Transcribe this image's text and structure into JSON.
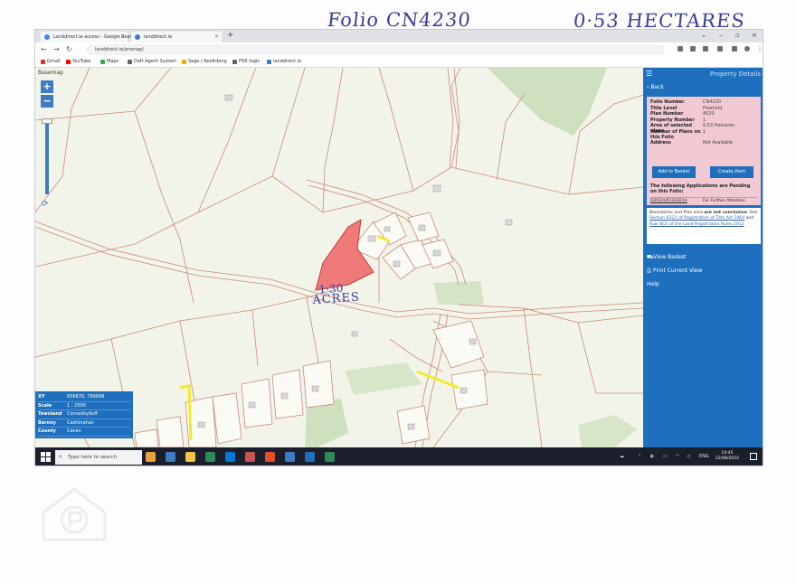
{
  "handwritten": {
    "folio": "Folio CN4230",
    "hectares": "0·53 HECTARES",
    "acres_line1": "1·30",
    "acres_line2": "ACRES"
  },
  "browser": {
    "tabs": [
      {
        "label": "Landdirect.ie access - Google Search",
        "color": "#4285f4"
      },
      {
        "label": "landdirect.ie",
        "color": "#3e7cc3"
      }
    ],
    "new_tab": "+",
    "url": "landdirect.ie/pramap/",
    "bookmarks": [
      {
        "label": "Gmail",
        "color": "#d93025"
      },
      {
        "label": "YouTube",
        "color": "#ff0000"
      },
      {
        "label": "Maps",
        "color": "#34a853"
      },
      {
        "label": "Daft Agent System",
        "color": "#5f6368"
      },
      {
        "label": "Sage | Realtdeng",
        "color": "#f9ab00"
      },
      {
        "label": "PSR login",
        "color": "#5f6368"
      },
      {
        "label": "landdirect.ie",
        "color": "#3e7cc3"
      }
    ]
  },
  "map": {
    "basemap_label": "Basemap",
    "zoom_in": "+",
    "zoom_out": "−",
    "colors": {
      "land": "#f2f4e9",
      "boundary": "#c98a7a",
      "highlight": "#f07a7a",
      "highlight_stroke": "#c03a3a",
      "yellow": "#f4ea2a",
      "forest": "#cfe0bf",
      "building": "#d8d8d8"
    },
    "info": [
      {
        "key": "XY",
        "value": "656870, 789999"
      },
      {
        "key": "Scale",
        "value": "1 : 2500"
      },
      {
        "key": "Townland",
        "value": "Cornadoyduff"
      },
      {
        "key": "Barony",
        "value": "Castlerahan"
      },
      {
        "key": "County",
        "value": "Cavan"
      }
    ]
  },
  "panel": {
    "title": "Property Details",
    "back": "Back",
    "fields": [
      {
        "key": "Folio Number",
        "value": "CN4230"
      },
      {
        "key": "Title Level",
        "value": "Freehold"
      },
      {
        "key": "Plan Number",
        "value": "4020"
      },
      {
        "key": "Property Number",
        "value": "1"
      },
      {
        "key": "Area of selected plans",
        "value": "0.53 Hectares"
      },
      {
        "key": "Number of Plans on this Folio",
        "value": "1"
      },
      {
        "key": "Address",
        "value": "Not Available"
      }
    ],
    "add_to_basket": "Add to Basket",
    "create_alert": "Create Alert",
    "pending_text": "The following Applications are Pending on this Folio:",
    "pending_ref": "D2022LR131821A",
    "pending_status": "For Further Attention",
    "notice_1": "Boundaries and Plan area ",
    "notice_bold": "are not conclusive",
    "notice_2": ". See ",
    "notice_link1": "Section 62(2) of Registration of Title Act 1964",
    "notice_3": " and ",
    "notice_link2": "Rule 8(2) of the Land Registration Rules 2012",
    "view_basket": "View Basket",
    "print_view": "Print Current View",
    "help": "Help"
  },
  "taskbar": {
    "search_placeholder": "Type here to search",
    "language": "ENG",
    "time": "14:45",
    "date": "22/08/2022",
    "app_colors": [
      "#e8a33d",
      "#3e7cc3",
      "#f4c542",
      "#2e8b57",
      "#0078d4",
      "#2e8b57",
      "#c75450",
      "#e34f26",
      "#3e7cc3",
      "#1f6fbf",
      "#2e8b57"
    ]
  }
}
